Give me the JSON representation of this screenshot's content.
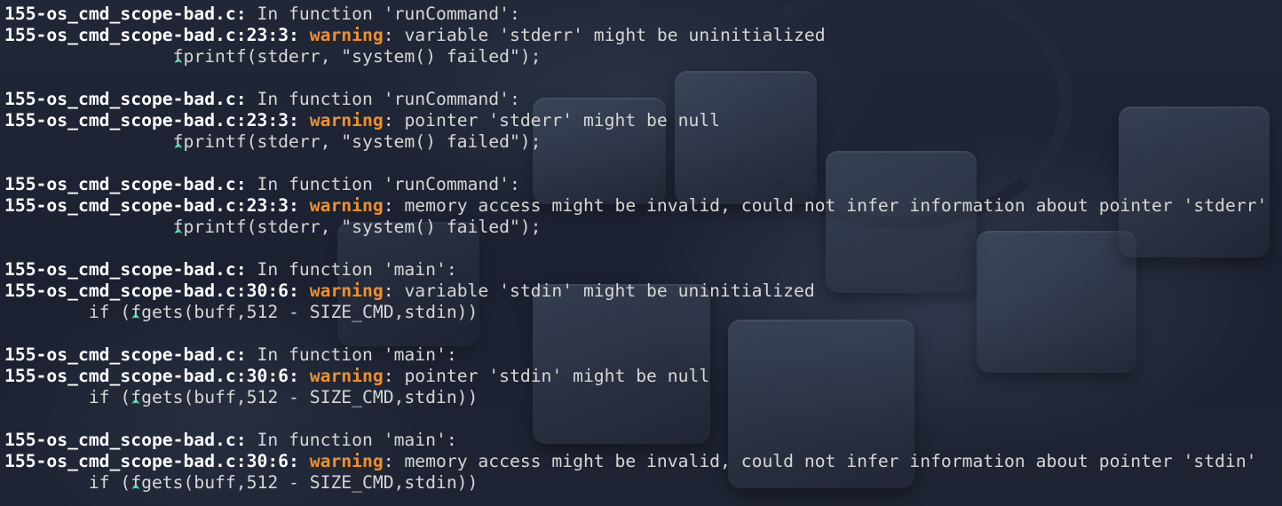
{
  "terminal": {
    "blocks": [
      {
        "header_file": "155-os_cmd_scope-bad.c:",
        "header_text": " In function 'runCommand':",
        "loc": "155-os_cmd_scope-bad.c:23:3:",
        "severity": "warning",
        "message": ": variable 'stderr' might be uninitialized",
        "code": "                fprintf(stderr, \"system() failed\");",
        "caret": "^"
      },
      {
        "header_file": "155-os_cmd_scope-bad.c:",
        "header_text": " In function 'runCommand':",
        "loc": "155-os_cmd_scope-bad.c:23:3:",
        "severity": "warning",
        "message": ": pointer 'stderr' might be null",
        "code": "                fprintf(stderr, \"system() failed\");",
        "caret": "^"
      },
      {
        "header_file": "155-os_cmd_scope-bad.c:",
        "header_text": " In function 'runCommand':",
        "loc": "155-os_cmd_scope-bad.c:23:3:",
        "severity": "warning",
        "message": ": memory access might be invalid, could not infer information about pointer 'stderr'",
        "code": "                fprintf(stderr, \"system() failed\");",
        "caret": "^"
      },
      {
        "header_file": "155-os_cmd_scope-bad.c:",
        "header_text": " In function 'main':",
        "loc": "155-os_cmd_scope-bad.c:30:6:",
        "severity": "warning",
        "message": ": variable 'stdin' might be uninitialized",
        "code": "        if (fgets(buff,512 - SIZE_CMD,stdin))",
        "caret": "^"
      },
      {
        "header_file": "155-os_cmd_scope-bad.c:",
        "header_text": " In function 'main':",
        "loc": "155-os_cmd_scope-bad.c:30:6:",
        "severity": "warning",
        "message": ": pointer 'stdin' might be null",
        "code": "        if (fgets(buff,512 - SIZE_CMD,stdin))",
        "caret": "^"
      },
      {
        "header_file": "155-os_cmd_scope-bad.c:",
        "header_text": " In function 'main':",
        "loc": "155-os_cmd_scope-bad.c:30:6:",
        "severity": "warning",
        "message": ": memory access might be invalid, could not infer information about pointer 'stdin'",
        "code": "        if (fgets(buff,512 - SIZE_CMD,stdin))",
        "caret": "^"
      }
    ]
  },
  "colors": {
    "background": "#1c2230",
    "text": "#d6d6d6",
    "filename": "#ffffff",
    "warning": "#f0902c",
    "caret": "#4ee0b4"
  }
}
